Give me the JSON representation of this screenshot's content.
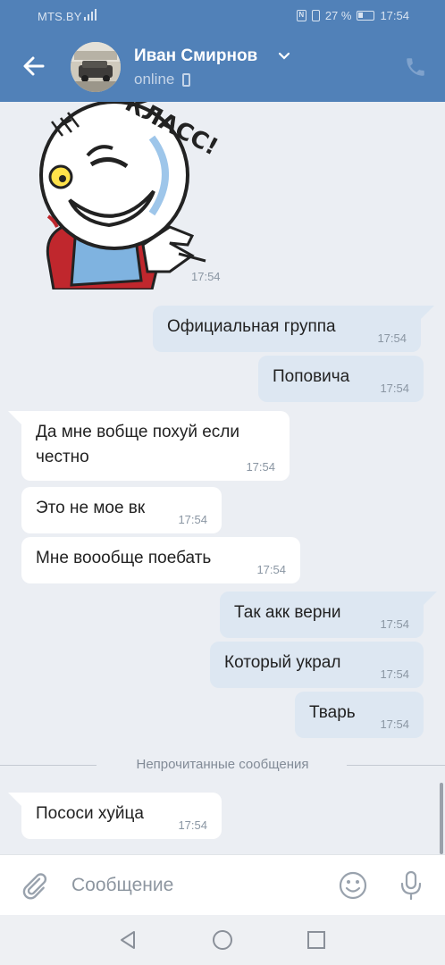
{
  "status_bar": {
    "carrier": "MTS.BY",
    "battery": "27 %",
    "time": "17:54"
  },
  "header": {
    "contact_name": "Иван Смирнов",
    "status": "online"
  },
  "sticker": {
    "text": "КЛАСС!",
    "time": "17:54"
  },
  "messages": [
    {
      "dir": "out",
      "text": "Официальная группа",
      "time": "17:54"
    },
    {
      "dir": "out",
      "text": "Поповича",
      "time": "17:54"
    },
    {
      "dir": "in",
      "text": "Да мне вобще похуй если честно",
      "time": "17:54"
    },
    {
      "dir": "in",
      "text": "Это не мое вк",
      "time": "17:54"
    },
    {
      "dir": "in",
      "text": "Мне воообще поебать",
      "time": "17:54"
    },
    {
      "dir": "out",
      "text": "Так акк верни",
      "time": "17:54"
    },
    {
      "dir": "out",
      "text": "Который украл",
      "time": "17:54"
    },
    {
      "dir": "out",
      "text": "Тварь",
      "time": "17:54"
    },
    {
      "dir": "in",
      "text": "Пососи хуйца",
      "time": "17:54"
    }
  ],
  "unread_divider": "Непрочитанные сообщения",
  "input": {
    "placeholder": "Сообщение"
  },
  "colors": {
    "header": "#5181b8",
    "background": "#ebeef3",
    "incoming_bubble": "#ffffff",
    "outgoing_bubble": "#dde7f2"
  },
  "icons": [
    "back-arrow-icon",
    "chevron-down-icon",
    "phone-call-icon",
    "paperclip-icon",
    "emoji-icon",
    "microphone-icon",
    "nav-back-icon",
    "nav-home-icon",
    "nav-recents-icon"
  ]
}
